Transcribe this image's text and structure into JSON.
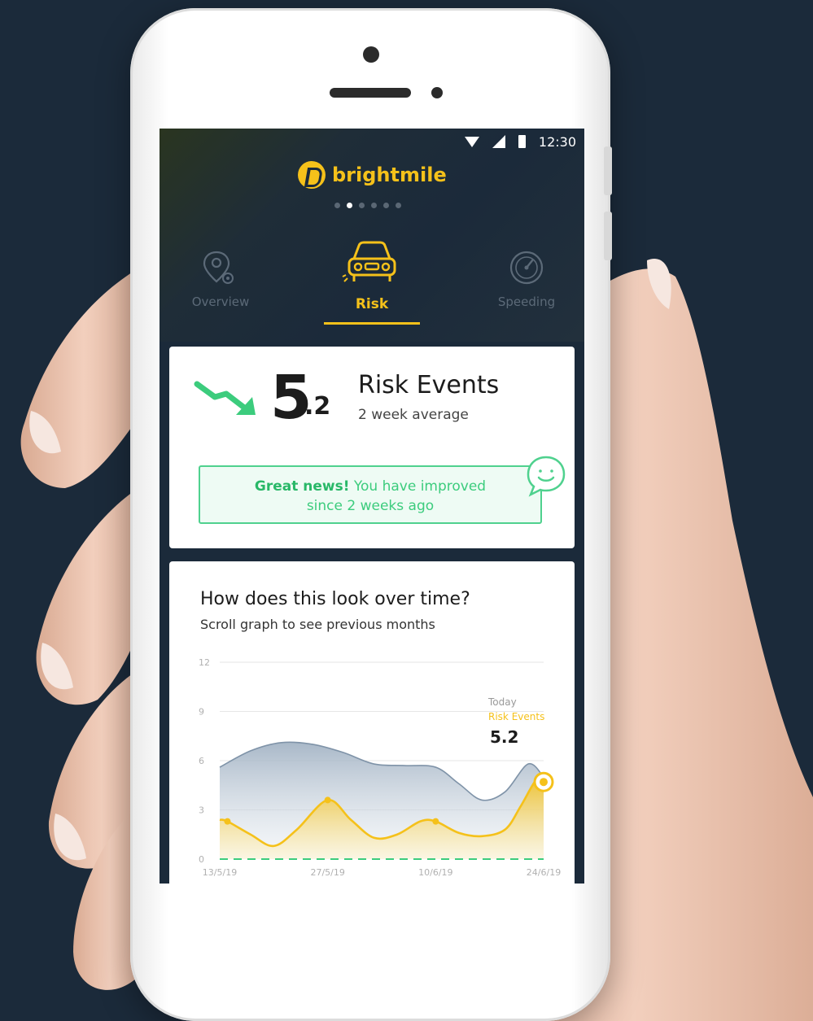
{
  "status_bar": {
    "time": "12:30"
  },
  "app": {
    "brand": "brightmile"
  },
  "carousel": {
    "count": 6,
    "active_index": 1
  },
  "tabs": [
    {
      "label": "Overview",
      "icon": "location-pin-icon",
      "active": false
    },
    {
      "label": "Risk",
      "icon": "car-icon",
      "active": true
    },
    {
      "label": "Speeding",
      "icon": "speedometer-icon",
      "active": false
    }
  ],
  "risk_card": {
    "number_main": "5",
    "number_decimal": ".2",
    "title": "Risk Events",
    "subtitle": "2 week average",
    "trend_icon": "trend-down-arrow-icon",
    "trend_color": "#3ccc7d",
    "news_bold": "Great news!",
    "news_text_1": " You have improved",
    "news_text_2": "since 2 weeks ago",
    "news_icon": "smiley-bubble-icon"
  },
  "chart_card": {
    "title": "How does this look over time?",
    "subtitle": "Scroll graph to see previous months",
    "tooltip_label": "Today",
    "tooltip_series": "Risk Events",
    "tooltip_value": "5.2"
  },
  "colors": {
    "brand_yellow": "#f5c11a",
    "dark_navy": "#1b2a3a",
    "green": "#3ccc7d",
    "grey_area": "#a9b7c6"
  },
  "chart_data": {
    "type": "area",
    "title": "",
    "xlabel": "",
    "ylabel": "",
    "ylim": [
      0,
      12
    ],
    "yticks": [
      "0",
      "3",
      "6",
      "9",
      "12"
    ],
    "xticks": [
      {
        "label": "13/5/19",
        "x": 0
      },
      {
        "label": "27/5/19",
        "x": 14
      },
      {
        "label": "10/6/19",
        "x": 28
      },
      {
        "label": "24/6/19",
        "x": 42
      }
    ],
    "grid": true,
    "series": [
      {
        "name": "",
        "color": "#a9b7c6",
        "x": [
          0,
          4,
          8,
          12,
          16,
          20,
          24,
          28,
          31,
          34,
          37,
          40,
          42
        ],
        "values": [
          5.6,
          6.6,
          7.1,
          7.0,
          6.5,
          5.8,
          5.7,
          5.6,
          4.6,
          3.6,
          4.1,
          5.8,
          5.0
        ]
      },
      {
        "name": "Risk Events",
        "color": "#f5c11a",
        "x": [
          0,
          1,
          4,
          7,
          10,
          14,
          17,
          20,
          23,
          26,
          28,
          31,
          34,
          37,
          39,
          41,
          42
        ],
        "values": [
          2.4,
          2.3,
          1.5,
          0.8,
          1.8,
          3.6,
          2.4,
          1.3,
          1.5,
          2.3,
          2.3,
          1.6,
          1.4,
          1.8,
          3.2,
          4.8,
          4.7
        ]
      }
    ],
    "baseline": {
      "value": 0,
      "style": "dashed",
      "color": "#3ccc7d"
    },
    "highlight": {
      "x": 42,
      "y": 4.7
    }
  }
}
